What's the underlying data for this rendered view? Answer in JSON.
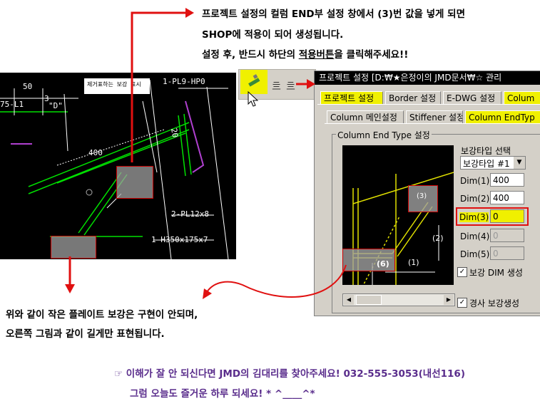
{
  "instructions": {
    "line1": "프로젝트 설정의 컬럼 END부 설정 창에서 (3)번 값을 넣게 되면",
    "line2": "SHOP에 적용이 되어 생성됩니다.",
    "line3_pre": "설정 후, 반드시 하단의 ",
    "line3_link": "적용버튼",
    "line3_post": "을 클릭해주세요!!"
  },
  "cad": {
    "note_box": "제거표하는 보강 표시",
    "labels": {
      "pl9": "1-PL9-HP0",
      "dim50": "50",
      "dim3": "3",
      "dimD": "\"D\"",
      "dim75": "75-L1",
      "dim400": "400",
      "dim20": "20",
      "pl12": "2-PL12x8",
      "h350": "1-H350x175x7"
    }
  },
  "dialog": {
    "title": "프로젝트 설정  [D:₩★은정이의 JMD문서₩☆ 관리",
    "tabs_row1": [
      "프로젝트 설정",
      "Border 설정",
      "E-DWG 설정",
      "Colum"
    ],
    "tabs_row2": [
      "Column 메인설정",
      "Stiffener 설정",
      "Column EndTyp"
    ],
    "group_label": "Column End Type 설정",
    "preview_labels": {
      "six": "(6)",
      "one": "(1)",
      "two": "(2)",
      "three": "(3)"
    },
    "reinforce_label": "보강타입 선택",
    "reinforce_selected": "보강타입 #1",
    "fields": [
      {
        "label": "Dim(1)",
        "value": "400",
        "enabled": true
      },
      {
        "label": "Dim(2)",
        "value": "400",
        "enabled": true
      },
      {
        "label": "Dim(3)",
        "value": "0",
        "enabled": true
      },
      {
        "label": "Dim(4)",
        "value": "0",
        "enabled": false
      },
      {
        "label": "Dim(5)",
        "value": "0",
        "enabled": false
      }
    ],
    "check_dim": "보강 DIM 생성",
    "check_slope": "경사 보강생성"
  },
  "notes": {
    "line1": "위와 같이 작은 플레이트 보강은 구현이 안되며,",
    "line2": "오른쪽 그림과 같이 길게만 표현됩니다."
  },
  "contact": {
    "line1": "☞ 이해가 잘 안 되신다면 JMD의 김대리를 찾아주세요!  032-555-3053(내선116)",
    "line2": "그럼 오늘도 즐거운 하루 되세요! * ^____^*"
  },
  "colors": {
    "arrow_red": "#e01010",
    "highlight_yellow": "#f0f000",
    "contact_purple": "#5a2d8c",
    "cad_green": "#00e000"
  }
}
